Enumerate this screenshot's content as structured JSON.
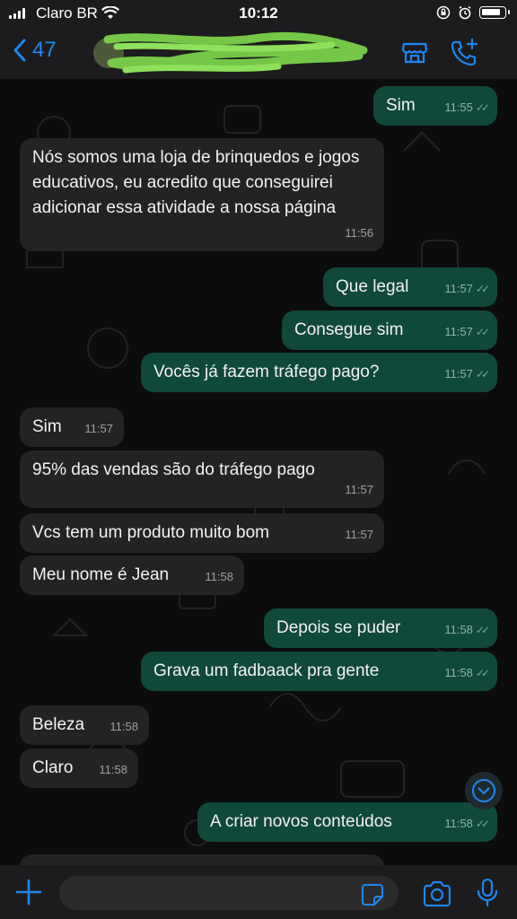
{
  "status_bar": {
    "carrier": "Claro BR",
    "time": "10:12"
  },
  "header": {
    "back_count": "47",
    "contact_name": "",
    "icons": [
      "back-chevron-icon",
      "store-icon",
      "add-call-icon"
    ]
  },
  "messages": [
    {
      "dir": "out",
      "text": "Sim",
      "time": "11:55"
    },
    {
      "dir": "in",
      "text": "Nós somos uma loja de brinquedos e jogos educativos, eu acredito que conseguirei adicionar essa atividade a nossa página",
      "time": "11:56"
    },
    {
      "dir": "out",
      "text": "Que legal",
      "time": "11:57"
    },
    {
      "dir": "out",
      "text": "Consegue sim",
      "time": "11:57"
    },
    {
      "dir": "out",
      "text": "Vocês já fazem tráfego pago?",
      "time": "11:57"
    },
    {
      "dir": "in",
      "text": "Sim",
      "time": "11:57"
    },
    {
      "dir": "in",
      "text": "95% das vendas são do tráfego pago",
      "time": "11:57"
    },
    {
      "dir": "in",
      "text": "Vcs tem um produto muito bom",
      "time": "11:57"
    },
    {
      "dir": "in",
      "text": "Meu nome é Jean",
      "time": "11:58"
    },
    {
      "dir": "out",
      "text": "Depois se puder",
      "time": "11:58"
    },
    {
      "dir": "out",
      "text": "Grava um fadbaack pra gente",
      "time": "11:58"
    },
    {
      "dir": "in",
      "text": "Beleza",
      "time": "11:58"
    },
    {
      "dir": "in",
      "text": "Claro",
      "time": "11:58"
    },
    {
      "dir": "out",
      "text": "A criar novos conteúdos",
      "time": "11:58"
    }
  ],
  "input": {
    "placeholder": ""
  },
  "colors": {
    "accent": "#1e87f0",
    "outgoing_bubble": "#10483a",
    "incoming_bubble": "#232325",
    "background": "#0b0b0b"
  }
}
